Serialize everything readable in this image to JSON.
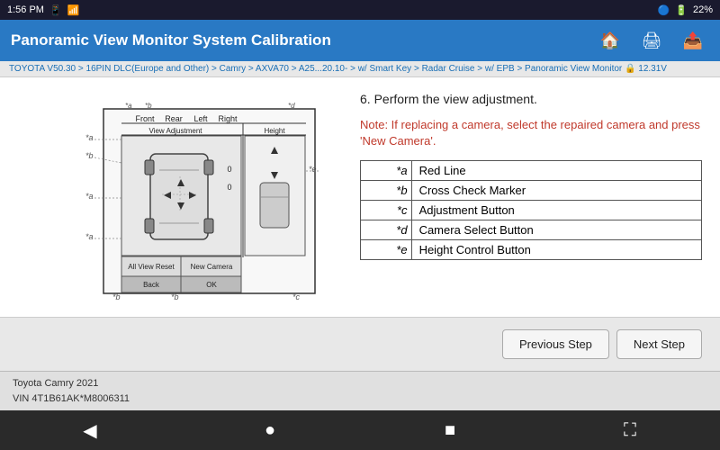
{
  "statusBar": {
    "time": "1:56 PM",
    "battery": "22%",
    "voltage": "12.31V"
  },
  "header": {
    "title": "Panoramic View Monitor System Calibration",
    "homeIcon": "🏠",
    "printIcon": "🖨",
    "exportIcon": "📤"
  },
  "breadcrumb": {
    "text": "TOYOTA V50.30 > 16PIN DLC(Europe and Other) > Camry > AXVA70 > A25...20.10- > w/ Smart Key > Radar Cruise > w/ EPB > Panoramic View Monitor 🔒 12.31V"
  },
  "content": {
    "stepText": "6. Perform the view adjustment.",
    "noteText": "Note: If replacing a camera, select the repaired camera and press 'New Camera'.",
    "legend": [
      {
        "key": "*a",
        "value": "Red Line"
      },
      {
        "key": "*b",
        "value": "Cross Check Marker"
      },
      {
        "key": "*c",
        "value": "Adjustment Button"
      },
      {
        "key": "*d",
        "value": "Camera Select Button"
      },
      {
        "key": "*e",
        "value": "Height Control Button"
      }
    ]
  },
  "actions": {
    "previousLabel": "Previous Step",
    "nextLabel": "Next Step"
  },
  "footer": {
    "line1": "Toyota Camry 2021",
    "line2": "VIN 4T1B61AK*M8006311"
  },
  "navBar": {
    "backIcon": "◀",
    "homeIcon": "●",
    "menuIcon": "■",
    "resizeIcon": "⛶"
  }
}
